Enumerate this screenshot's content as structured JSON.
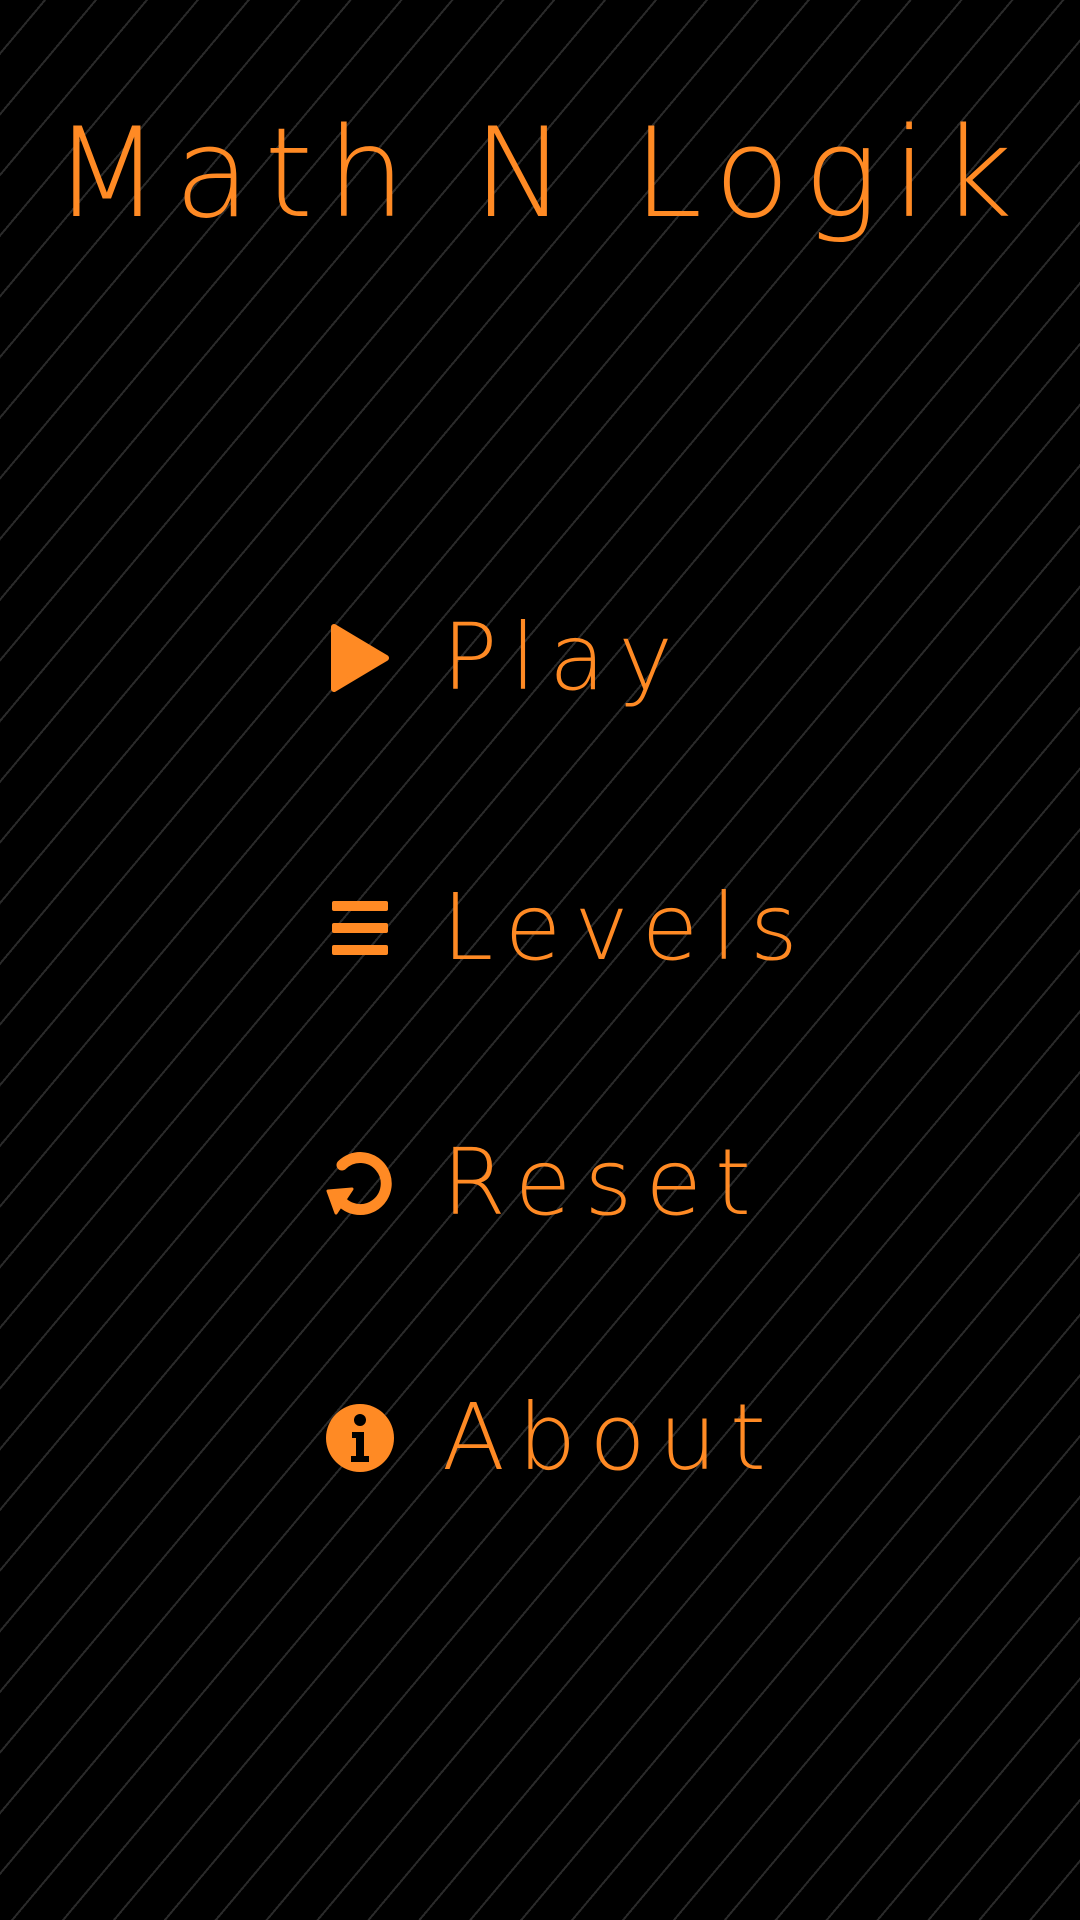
{
  "app": {
    "title": "Math N Logik"
  },
  "theme": {
    "accent": "#ff8a24",
    "background": "#000000",
    "stripe": "#2a2a2a"
  },
  "menu": {
    "items": [
      {
        "label": "Play",
        "icon": "play-icon"
      },
      {
        "label": "Levels",
        "icon": "list-icon"
      },
      {
        "label": "Reset",
        "icon": "reset-icon"
      },
      {
        "label": "About",
        "icon": "info-icon"
      }
    ]
  }
}
